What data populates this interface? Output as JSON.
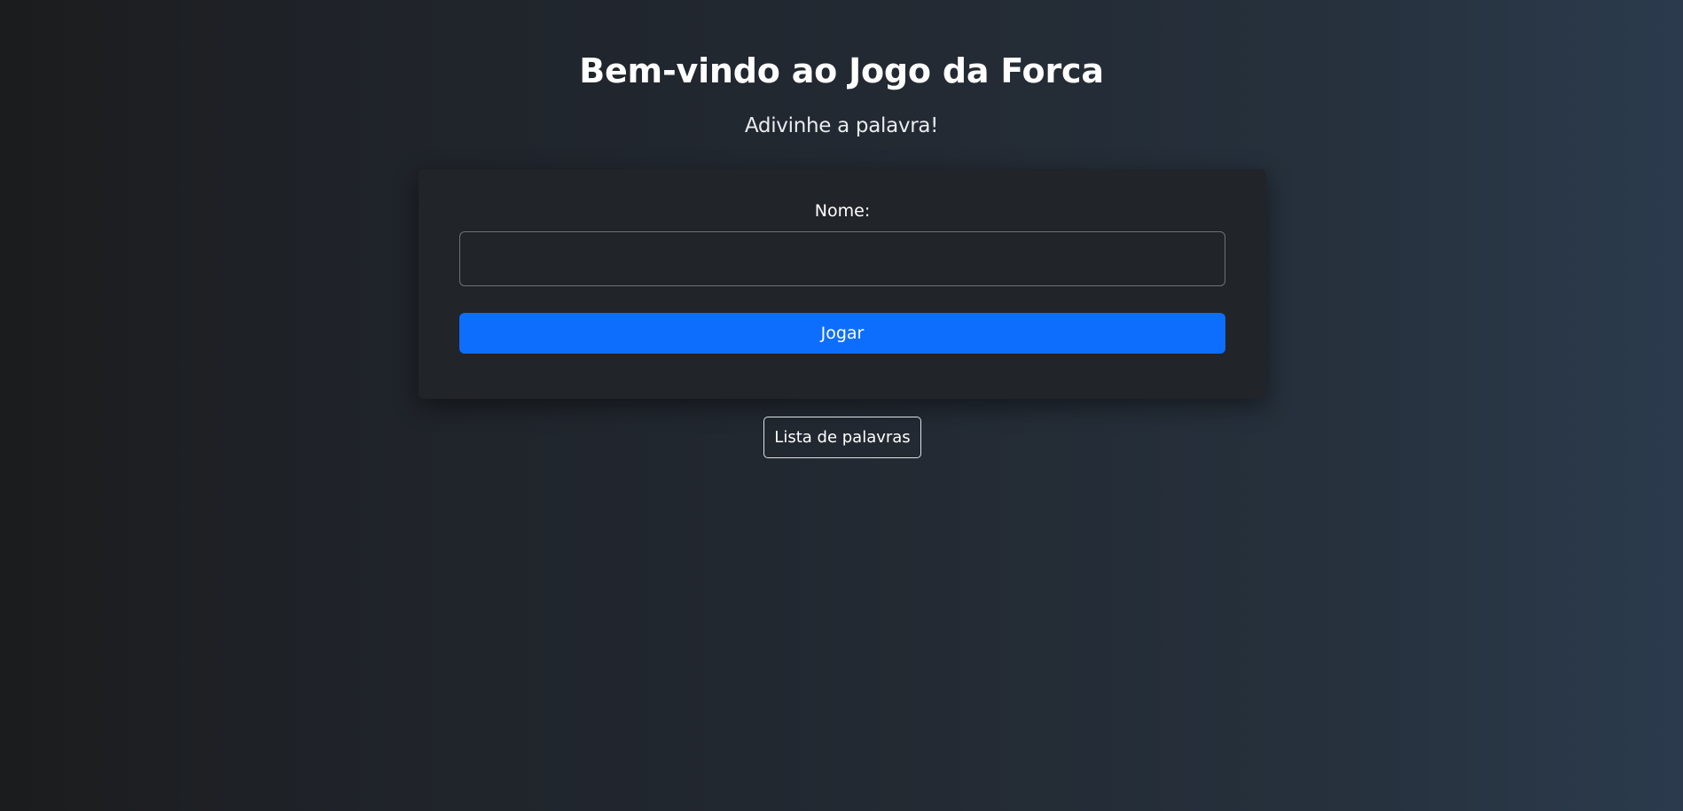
{
  "header": {
    "title": "Bem-vindo ao Jogo da Forca",
    "subtitle": "Adivinhe a palavra!"
  },
  "form": {
    "name_label": "Nome:",
    "name_value": "",
    "name_placeholder": "",
    "submit_label": "Jogar"
  },
  "links": {
    "word_list_label": "Lista de palavras"
  },
  "colors": {
    "primary": "#0d6efd",
    "card_background": "#212428",
    "input_border": "#6c727a",
    "outline_button_border": "#dee2e6"
  }
}
